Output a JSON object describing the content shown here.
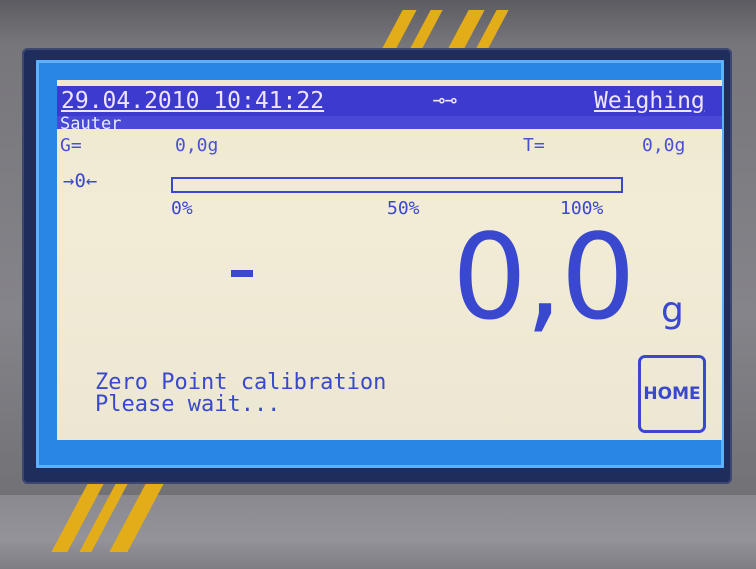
{
  "header": {
    "datetime": "29.04.2010 10:41:22",
    "key_symbol": "⊸⊸",
    "mode": "Weighing",
    "brand": "Sauter"
  },
  "readouts": {
    "gross_label": "G=",
    "gross_value": "0,0g",
    "tare_label": "T=",
    "tare_value": "0,0g"
  },
  "zero_indicator": "→0←",
  "capacity_bar": {
    "label_0": "0%",
    "label_50": "50%",
    "label_100": "100%",
    "fill_fraction": 0
  },
  "weight": {
    "value": "0,0",
    "unit": "g"
  },
  "message": {
    "line1": "Zero Point calibration",
    "line2": "Please wait..."
  },
  "buttons": {
    "home": "HOME"
  },
  "colors": {
    "lcd_bg": "#efe8cf",
    "lcd_text": "#3a48d0",
    "status_bar": "#3d3ad0",
    "frame_blue": "#2a86e4",
    "stripe_yellow": "#e3ad19"
  }
}
